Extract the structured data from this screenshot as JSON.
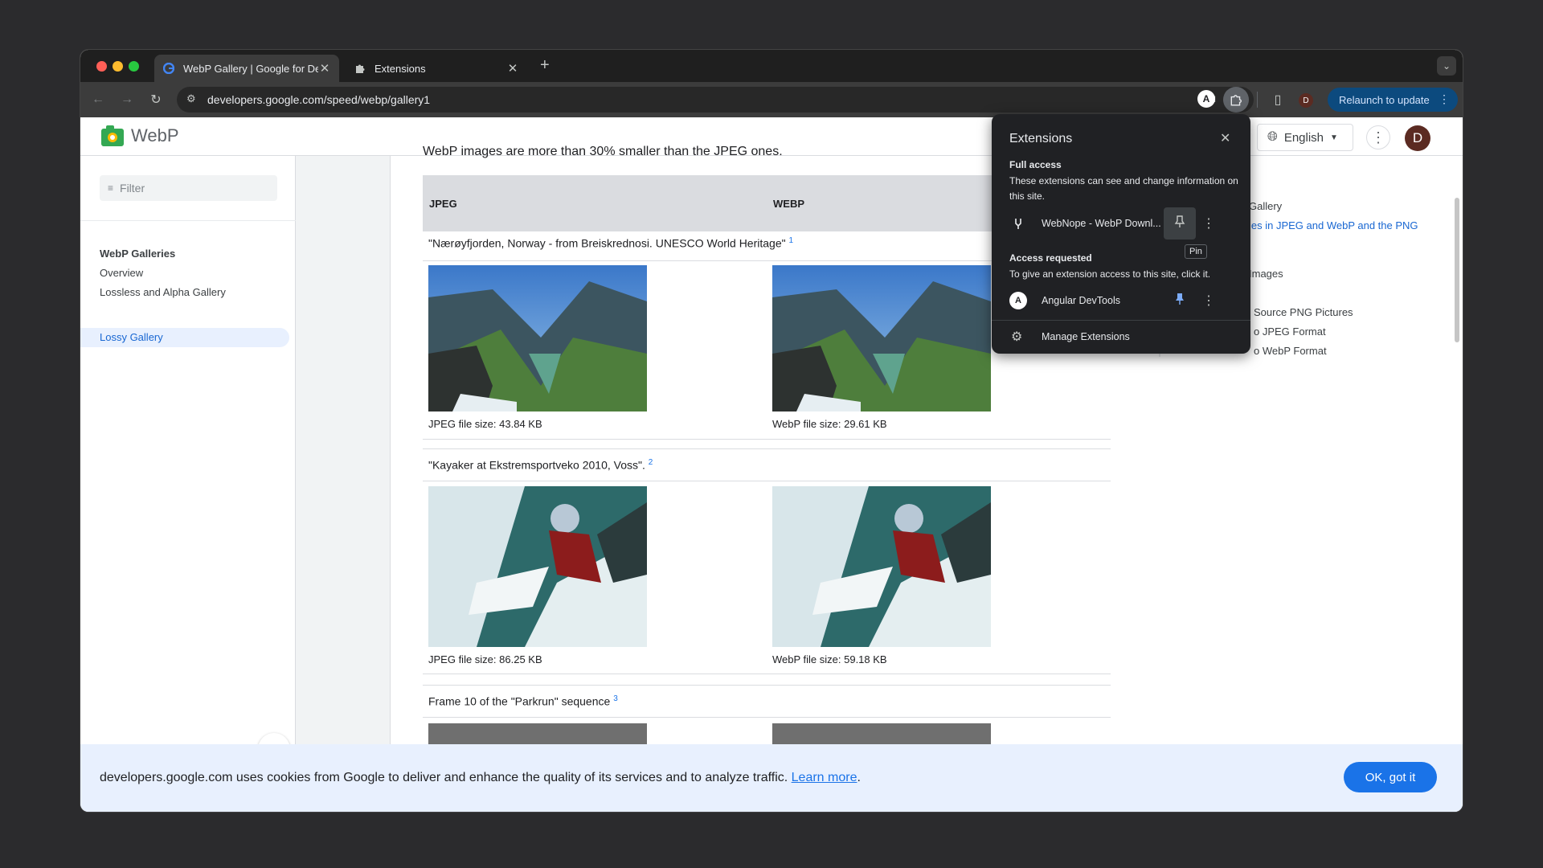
{
  "browser": {
    "tabs": [
      {
        "title": "WebP Gallery  |  Google for Developers",
        "active": true
      },
      {
        "title": "Extensions",
        "active": false
      }
    ],
    "new_tab": "+",
    "url": "developers.google.com/speed/webp/gallery1",
    "profile_initial": "D",
    "relaunch_label": "Relaunch to update"
  },
  "site": {
    "logo": "WebP",
    "language": "English",
    "avatar_initial": "D"
  },
  "sidebar": {
    "filter_placeholder": "Filter",
    "heading": "WebP Galleries",
    "items": [
      {
        "label": "Overview"
      },
      {
        "label": "Lossless and Alpha Gallery"
      },
      {
        "label": "Lossy Gallery"
      }
    ],
    "active_index": 2
  },
  "content": {
    "cut_text": "WebP images are more than 30% smaller than the JPEG ones.",
    "col_headers": [
      "JPEG",
      "WEBP"
    ],
    "rows": [
      {
        "caption": "\"Nærøyfjorden, Norway - from Breiskrednosi. UNESCO World Heritage\"",
        "ref": "1",
        "jpeg_size": "JPEG file size: 43.84 KB",
        "webp_size": "WebP file size: 29.61 KB"
      },
      {
        "caption": "\"Kayaker at Ekstremsportveko 2010, Voss\".",
        "ref": "2",
        "jpeg_size": "JPEG file size: 86.25 KB",
        "webp_size": "WebP file size: 59.18 KB"
      },
      {
        "caption": "Frame 10 of the \"Parkrun\" sequence",
        "ref": "3"
      }
    ]
  },
  "toc": {
    "items": [
      "Gallery",
      "les in JPEG and WebP and the PNG",
      "Images",
      "Source PNG Pictures",
      "o JPEG Format",
      "o WebP Format"
    ]
  },
  "cookie": {
    "text": "developers.google.com uses cookies from Google to deliver and enhance the quality of its services and to analyze traffic.",
    "link": "Learn more",
    "period": ".",
    "ok": "OK, got it"
  },
  "extensions_popup": {
    "title": "Extensions",
    "full_access_heading": "Full access",
    "full_access_text": "These extensions can see and change information on this site.",
    "full_access_items": [
      {
        "name": "WebNope - WebP Downl...",
        "pinned": false
      }
    ],
    "pin_tooltip": "Pin",
    "access_requested_heading": "Access requested",
    "access_requested_text": "To give an extension access to this site, click it.",
    "requested_items": [
      {
        "name": "Angular DevTools",
        "pinned": true
      }
    ],
    "manage_label": "Manage Extensions"
  },
  "colors": {
    "accent": "#1a73e8",
    "relaunch_bg": "#0c4a7e",
    "pin_active": "#7cacf8"
  }
}
